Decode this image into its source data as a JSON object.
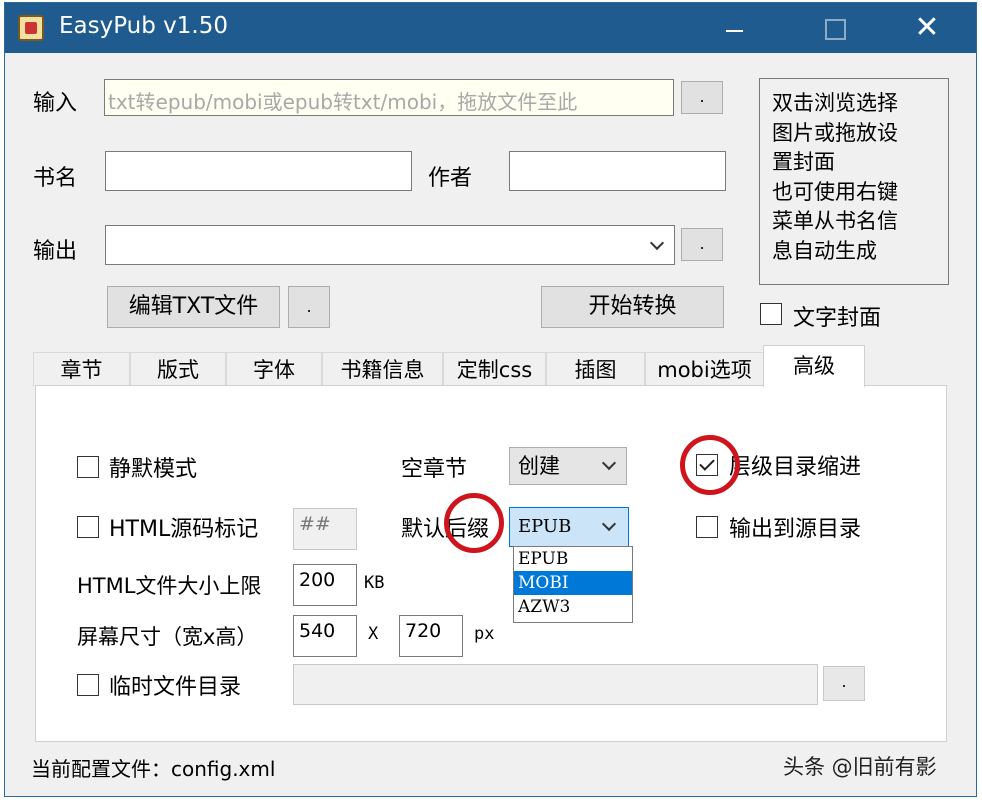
{
  "window": {
    "title": "EasyPub v1.50",
    "close_glyph": "✕"
  },
  "input_row": {
    "label": "输入",
    "placeholder": "txt转epub/mobi或epub转txt/mobi，拖放文件至此",
    "browse": "."
  },
  "book_row": {
    "title_label": "书名",
    "author_label": "作者",
    "title_value": "",
    "author_value": ""
  },
  "output_row": {
    "label": "输出",
    "value": "",
    "browse": "."
  },
  "buttons": {
    "edit_txt": "编辑TXT文件",
    "edit_dot": ".",
    "start": "开始转换"
  },
  "cover": {
    "lines": [
      "双击浏览选择",
      "图片或拖放设",
      "置封面",
      "也可使用右键",
      "菜单从书名信",
      "息自动生成"
    ],
    "text_cover": "文字封面"
  },
  "tabs": [
    "章节",
    "版式",
    "字体",
    "书籍信息",
    "定制css",
    "插图",
    "mobi选项",
    "高级"
  ],
  "advanced": {
    "silent_mode": "静默模式",
    "html_mark": "HTML源码标记",
    "html_mark_value": "##",
    "html_max_label": "HTML文件大小上限",
    "html_max_value": "200",
    "html_max_unit": "KB",
    "screen_label": "屏幕尺寸（宽x高）",
    "screen_w": "540",
    "screen_x": "X",
    "screen_h": "720",
    "screen_unit": "px",
    "temp_dir": "临时文件目录",
    "temp_dir_browse": ".",
    "empty_chapter_label": "空章节",
    "empty_chapter_value": "创建",
    "suffix_label": "默认后缀",
    "suffix_value": "EPUB",
    "suffix_options": [
      "EPUB",
      "MOBI",
      "AZW3"
    ],
    "suffix_selected": "MOBI",
    "toc_indent": "层级目录缩进",
    "toc_indent_checked": true,
    "output_to_src": "输出到源目录"
  },
  "status": {
    "config": "当前配置文件：config.xml"
  },
  "watermark": "头条 @旧前有影"
}
